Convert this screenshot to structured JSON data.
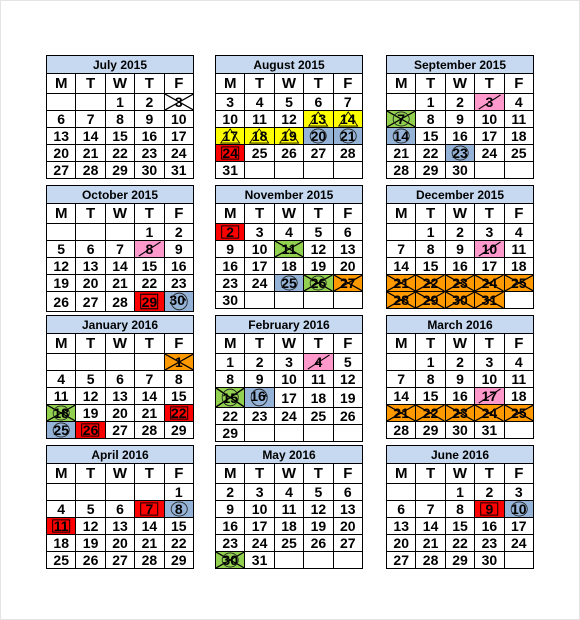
{
  "weekday_headers": [
    "M",
    "T",
    "W",
    "T",
    "F"
  ],
  "colors": {
    "header": "#c6d9f1",
    "yellow": "#ffff00",
    "pink": "#ff99cc",
    "green": "#92d050",
    "orange": "#ff9900",
    "blue": "#95b3d7",
    "red": "#ff0000"
  },
  "months": [
    {
      "title": "July 2015",
      "weeks": [
        [
          null,
          null,
          1,
          2,
          3
        ],
        [
          6,
          7,
          8,
          9,
          10
        ],
        [
          13,
          14,
          15,
          16,
          17
        ],
        [
          20,
          21,
          22,
          23,
          24
        ],
        [
          27,
          28,
          29,
          30,
          31
        ]
      ],
      "marks": {
        "3": {
          "bg": null,
          "mark": "x"
        }
      }
    },
    {
      "title": "August 2015",
      "weeks": [
        [
          3,
          4,
          5,
          6,
          7
        ],
        [
          10,
          11,
          12,
          13,
          14
        ],
        [
          17,
          18,
          19,
          20,
          21
        ],
        [
          24,
          25,
          26,
          27,
          28
        ],
        [
          31,
          null,
          null,
          null,
          null
        ]
      ],
      "marks": {
        "13": {
          "bg": "yellow",
          "mark": "triangle"
        },
        "14": {
          "bg": "yellow",
          "mark": "triangle"
        },
        "17": {
          "bg": "yellow",
          "mark": "triangle"
        },
        "18": {
          "bg": "yellow",
          "mark": "triangle"
        },
        "19": {
          "bg": "yellow",
          "mark": "triangle"
        },
        "20": {
          "bg": "blue",
          "mark": "circle"
        },
        "21": {
          "bg": "blue",
          "mark": "circle"
        },
        "24": {
          "bg": "red",
          "mark": "box"
        }
      }
    },
    {
      "title": "September 2015",
      "weeks": [
        [
          null,
          1,
          2,
          3,
          4
        ],
        [
          7,
          8,
          9,
          10,
          11
        ],
        [
          14,
          15,
          16,
          17,
          18
        ],
        [
          21,
          22,
          23,
          24,
          25
        ],
        [
          28,
          29,
          30,
          null,
          null
        ]
      ],
      "marks": {
        "3": {
          "bg": "pink",
          "mark": "slash"
        },
        "7": {
          "bg": "green",
          "mark": "x-circle"
        },
        "14": {
          "bg": "blue",
          "mark": "circle"
        },
        "23": {
          "bg": "blue",
          "mark": "circle"
        }
      }
    },
    {
      "title": "October 2015",
      "weeks": [
        [
          null,
          null,
          null,
          1,
          2
        ],
        [
          5,
          6,
          7,
          8,
          9
        ],
        [
          12,
          13,
          14,
          15,
          16
        ],
        [
          19,
          20,
          21,
          22,
          23
        ],
        [
          26,
          27,
          28,
          29,
          30
        ]
      ],
      "marks": {
        "8": {
          "bg": "pink",
          "mark": "slash"
        },
        "29": {
          "bg": "red",
          "mark": "box"
        },
        "30": {
          "bg": "blue",
          "mark": "circle",
          "asterisk": "*"
        }
      }
    },
    {
      "title": "November 2015",
      "weeks": [
        [
          2,
          3,
          4,
          5,
          6
        ],
        [
          9,
          10,
          11,
          12,
          13
        ],
        [
          16,
          17,
          18,
          19,
          20
        ],
        [
          23,
          24,
          25,
          26,
          27
        ],
        [
          30,
          null,
          null,
          null,
          null
        ]
      ],
      "marks": {
        "2": {
          "bg": "red",
          "mark": "box"
        },
        "11": {
          "bg": "green",
          "mark": "x"
        },
        "25": {
          "bg": "blue",
          "mark": "circle"
        },
        "26": {
          "bg": "green",
          "mark": "x-circle"
        },
        "27": {
          "bg": "orange",
          "mark": "x"
        }
      }
    },
    {
      "title": "December 2015",
      "weeks": [
        [
          null,
          1,
          2,
          3,
          4
        ],
        [
          7,
          8,
          9,
          10,
          11
        ],
        [
          14,
          15,
          16,
          17,
          18
        ],
        [
          21,
          22,
          23,
          24,
          25
        ],
        [
          28,
          29,
          30,
          31,
          null
        ]
      ],
      "marks": {
        "10": {
          "bg": "pink",
          "mark": "slash"
        },
        "21": {
          "bg": "orange",
          "mark": "x"
        },
        "22": {
          "bg": "orange",
          "mark": "x"
        },
        "23": {
          "bg": "orange",
          "mark": "x"
        },
        "24": {
          "bg": "orange",
          "mark": "x"
        },
        "25": {
          "bg": "orange",
          "mark": "x"
        },
        "28": {
          "bg": "orange",
          "mark": "x"
        },
        "29": {
          "bg": "orange",
          "mark": "x"
        },
        "30": {
          "bg": "orange",
          "mark": "x"
        },
        "31": {
          "bg": "orange",
          "mark": "x"
        }
      }
    },
    {
      "title": "January 2016",
      "weeks": [
        [
          null,
          null,
          null,
          null,
          1
        ],
        [
          4,
          5,
          6,
          7,
          8
        ],
        [
          11,
          12,
          13,
          14,
          15
        ],
        [
          18,
          19,
          20,
          21,
          22
        ],
        [
          25,
          26,
          27,
          28,
          29
        ]
      ],
      "marks": {
        "1": {
          "bg": "orange",
          "mark": "x"
        },
        "18": {
          "bg": "green",
          "mark": "x-circle"
        },
        "22": {
          "bg": "red",
          "mark": "box"
        },
        "25": {
          "bg": "blue",
          "mark": "circle"
        },
        "26": {
          "bg": "red",
          "mark": "box"
        }
      }
    },
    {
      "title": "February 2016",
      "weeks": [
        [
          1,
          2,
          3,
          4,
          5
        ],
        [
          8,
          9,
          10,
          11,
          12
        ],
        [
          15,
          16,
          17,
          18,
          19
        ],
        [
          22,
          23,
          24,
          25,
          26
        ],
        [
          29,
          null,
          null,
          null,
          null
        ]
      ],
      "marks": {
        "4": {
          "bg": "pink",
          "mark": "slash"
        },
        "15": {
          "bg": "green",
          "mark": "x-circle"
        },
        "16": {
          "bg": "blue",
          "mark": "circle",
          "asterisk": "*"
        }
      }
    },
    {
      "title": "March 2016",
      "weeks": [
        [
          null,
          1,
          2,
          3,
          4
        ],
        [
          7,
          8,
          9,
          10,
          11
        ],
        [
          14,
          15,
          16,
          17,
          18
        ],
        [
          21,
          22,
          23,
          24,
          25
        ],
        [
          28,
          29,
          30,
          31,
          null
        ]
      ],
      "marks": {
        "17": {
          "bg": "pink",
          "mark": "slash"
        },
        "21": {
          "bg": "orange",
          "mark": "x"
        },
        "22": {
          "bg": "orange",
          "mark": "x"
        },
        "23": {
          "bg": "orange",
          "mark": "x"
        },
        "24": {
          "bg": "orange",
          "mark": "x"
        },
        "25": {
          "bg": "orange",
          "mark": "x"
        }
      }
    },
    {
      "title": "April 2016",
      "weeks": [
        [
          null,
          null,
          null,
          null,
          1
        ],
        [
          4,
          5,
          6,
          7,
          8
        ],
        [
          11,
          12,
          13,
          14,
          15
        ],
        [
          18,
          19,
          20,
          21,
          22
        ],
        [
          25,
          26,
          27,
          28,
          29
        ]
      ],
      "marks": {
        "7": {
          "bg": "red",
          "mark": "box"
        },
        "8": {
          "bg": "blue",
          "mark": "circle"
        },
        "11": {
          "bg": "red",
          "mark": "box"
        }
      }
    },
    {
      "title": "May 2016",
      "weeks": [
        [
          2,
          3,
          4,
          5,
          6
        ],
        [
          9,
          10,
          11,
          12,
          13
        ],
        [
          16,
          17,
          18,
          19,
          20
        ],
        [
          23,
          24,
          25,
          26,
          27
        ],
        [
          30,
          31,
          null,
          null,
          null
        ]
      ],
      "marks": {
        "30": {
          "bg": "green",
          "mark": "x-circle"
        }
      }
    },
    {
      "title": "June 2016",
      "weeks": [
        [
          null,
          null,
          1,
          2,
          3
        ],
        [
          6,
          7,
          8,
          9,
          10
        ],
        [
          13,
          14,
          15,
          16,
          17
        ],
        [
          20,
          21,
          22,
          23,
          24
        ],
        [
          27,
          28,
          29,
          30,
          null
        ]
      ],
      "marks": {
        "9": {
          "bg": "red",
          "mark": "box"
        },
        "10": {
          "bg": "blue",
          "mark": "circle"
        }
      }
    }
  ]
}
